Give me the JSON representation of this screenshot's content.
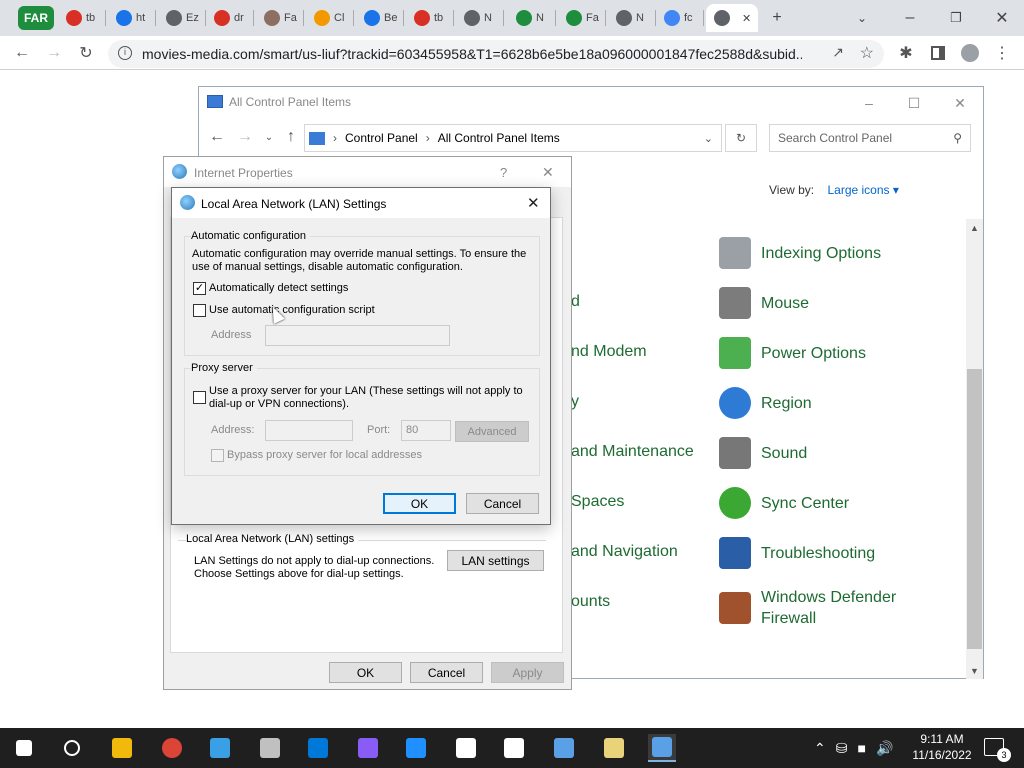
{
  "browser": {
    "tab_group_label": "FAR",
    "tabs": [
      {
        "label": "tb",
        "color": "#d93025"
      },
      {
        "label": "ht",
        "color": "#1a73e8"
      },
      {
        "label": "Ez",
        "color": "#5f6368"
      },
      {
        "label": "dr",
        "color": "#d93025"
      },
      {
        "label": "Fa",
        "color": "#8d6e63"
      },
      {
        "label": "Cl",
        "color": "#f29900"
      },
      {
        "label": "Be",
        "color": "#1a73e8"
      },
      {
        "label": "tb",
        "color": "#d93025"
      },
      {
        "label": "N",
        "color": "#5f6368"
      },
      {
        "label": "N",
        "color": "#1e8e3e"
      },
      {
        "label": "Fa",
        "color": "#1e8e3e"
      },
      {
        "label": "N",
        "color": "#5f6368"
      },
      {
        "label": "fc",
        "color": "#4285f4"
      },
      {
        "label": "",
        "color": "#5f6368"
      }
    ],
    "new_tab_glyph": "+",
    "url": "movies-media.com/smart/us-liuf?trackid=603455958&T1=6628b6e5be18a096000001847fec2588d&subid..."
  },
  "control_panel": {
    "title": "All Control Panel Items",
    "breadcrumb": [
      "Control Panel",
      "All Control Panel Items"
    ],
    "search_placeholder": "Search Control Panel",
    "view_by_label": "View by:",
    "view_by_value": "Large icons",
    "left_items": [
      "d",
      "nd Modem",
      "y",
      "and Maintenance",
      "Spaces",
      "and Navigation",
      "ounts"
    ],
    "right_items": [
      {
        "label": "Indexing Options",
        "icon": "indexing-icon"
      },
      {
        "label": "Mouse",
        "icon": "mouse-icon"
      },
      {
        "label": "Power Options",
        "icon": "power-icon"
      },
      {
        "label": "Region",
        "icon": "region-icon"
      },
      {
        "label": "Sound",
        "icon": "sound-icon"
      },
      {
        "label": "Sync Center",
        "icon": "sync-icon"
      },
      {
        "label": "Troubleshooting",
        "icon": "troubleshooting-icon"
      },
      {
        "label": "Windows Defender\nFirewall",
        "icon": "firewall-icon"
      }
    ]
  },
  "internet_properties": {
    "title": "Internet Properties",
    "help_glyph": "?",
    "lan_section_label": "Local Area Network (LAN) settings",
    "lan_section_text": "LAN Settings do not apply to dial-up connections.\nChoose Settings above for dial-up settings.",
    "lan_settings_button": "LAN settings",
    "ok": "OK",
    "cancel": "Cancel",
    "apply": "Apply"
  },
  "lan_dialog": {
    "title": "Local Area Network (LAN) Settings",
    "auto_group_label": "Automatic configuration",
    "auto_text": "Automatic configuration may override manual settings.  To ensure the use of manual settings, disable automatic configuration.",
    "auto_detect_label": "Automatically detect settings",
    "auto_detect_checked": true,
    "use_script_label": "Use automatic configuration script",
    "use_script_checked": false,
    "address_label": "Address",
    "address_value": "",
    "proxy_group_label": "Proxy server",
    "use_proxy_label": "Use a proxy server for your LAN (These settings will not apply to dial-up or VPN connections).",
    "use_proxy_checked": false,
    "proxy_address_label": "Address:",
    "proxy_address_value": "",
    "port_label": "Port:",
    "port_value": "80",
    "advanced_button": "Advanced",
    "bypass_label": "Bypass proxy server for local addresses",
    "bypass_checked": false,
    "ok": "OK",
    "cancel": "Cancel"
  },
  "taskbar": {
    "clock_time": "9:11 AM",
    "clock_date": "11/16/2022",
    "notification_count": "3",
    "apps": [
      "start-icon",
      "search-icon",
      "file-explorer-icon",
      "chrome-icon",
      "photos-icon",
      "paint-icon",
      "store-icon",
      "drop-icon",
      "wifi-app-icon",
      "settings-app-icon",
      "7zip-icon",
      "remote-desktop-icon",
      "pen-app-icon",
      "network-settings-icon"
    ]
  },
  "colors": {
    "tab_group": "#1e8e3e",
    "control_panel_link": "#1e6b32",
    "dialog_accent": "#0078d7",
    "taskbar": "#1f1f1f"
  }
}
